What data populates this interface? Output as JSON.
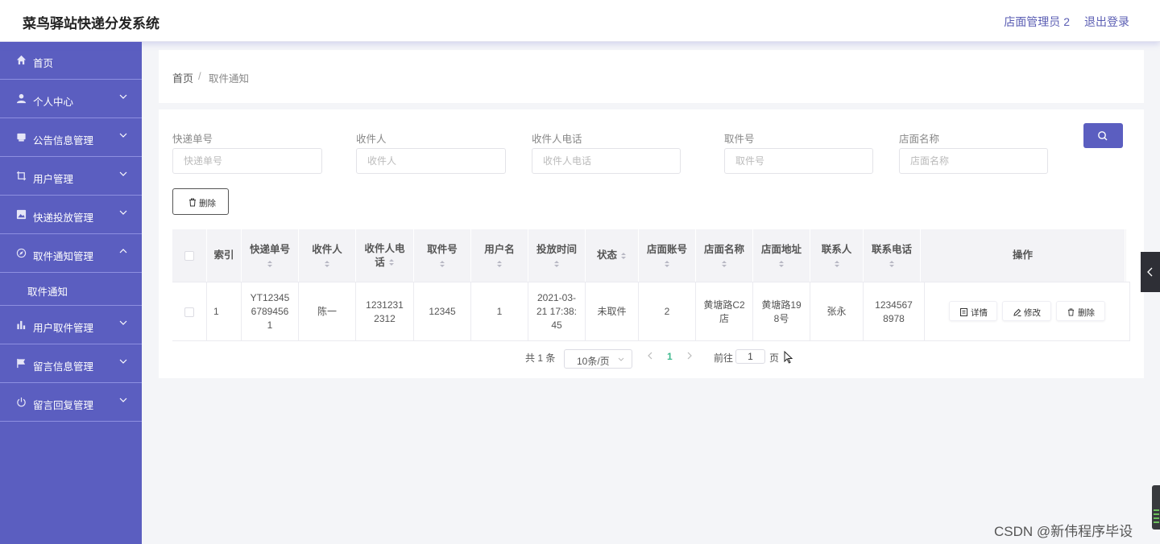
{
  "header": {
    "title": "菜鸟驿站快递分发系统",
    "user": "店面管理员 2",
    "logout": "退出登录"
  },
  "sidebar": {
    "items": [
      {
        "label": "首页",
        "icon": "home-icon"
      },
      {
        "label": "个人中心",
        "icon": "user-icon"
      },
      {
        "label": "公告信息管理",
        "icon": "notice-icon"
      },
      {
        "label": "用户管理",
        "icon": "crop-icon"
      },
      {
        "label": "快递投放管理",
        "icon": "image-icon"
      },
      {
        "label": "取件通知管理",
        "icon": "compass-icon",
        "expanded": true
      },
      {
        "label": "用户取件管理",
        "icon": "bar-chart-icon"
      },
      {
        "label": "留言信息管理",
        "icon": "flag-icon"
      },
      {
        "label": "留言回复管理",
        "icon": "power-icon"
      }
    ],
    "submenu": {
      "label": "取件通知"
    }
  },
  "breadcrumb": {
    "home": "首页",
    "separator": "/",
    "current": "取件通知"
  },
  "search": {
    "fields": [
      {
        "label": "快递单号",
        "placeholder": "快递单号"
      },
      {
        "label": "收件人",
        "placeholder": "收件人"
      },
      {
        "label": "收件人电话",
        "placeholder": "收件人电话"
      },
      {
        "label": "取件号",
        "placeholder": "取件号"
      },
      {
        "label": "店面名称",
        "placeholder": "店面名称"
      }
    ]
  },
  "toolbar": {
    "delete_label": "删除"
  },
  "table": {
    "headers": [
      "索引",
      "快递单号",
      "收件人",
      "收件人电话",
      "取件号",
      "用户名",
      "投放时间",
      "状态",
      "店面账号",
      "店面名称",
      "店面地址",
      "联系人",
      "联系电话",
      "操作"
    ],
    "header_lines": {
      "phone": [
        "收件人电",
        "话"
      ]
    },
    "rows": [
      {
        "index": "1",
        "tracking_no": [
          "YT12345",
          "67894561"
        ],
        "tracking_lines": [
          "YT12345",
          "6789456",
          "1"
        ],
        "recipient": "陈一",
        "phone_lines": [
          "1231231",
          "2312"
        ],
        "pickup_no": "12345",
        "username": "1",
        "time_lines": [
          "2021-03-",
          "21 17:38:",
          "45"
        ],
        "status": "未取件",
        "store_account": "2",
        "store_name_lines": [
          "黄塘路C2",
          "店"
        ],
        "store_addr_lines": [
          "黄塘路19",
          "8号"
        ],
        "contact": "张永",
        "contact_phone_lines": [
          "1234567",
          "8978"
        ]
      }
    ],
    "actions": {
      "detail": "详情",
      "edit": "修改",
      "delete": "删除"
    }
  },
  "pagination": {
    "total": "共 1 条",
    "page_size": "10条/页",
    "current": "1",
    "goto": "前往",
    "goto_value": "1",
    "page_suffix": "页"
  },
  "watermark": "CSDN @新伟程序毕设",
  "colors": {
    "sidebar": "#5b5ec0",
    "accent": "#5b5ec0",
    "active_page": "#3fb98e"
  }
}
